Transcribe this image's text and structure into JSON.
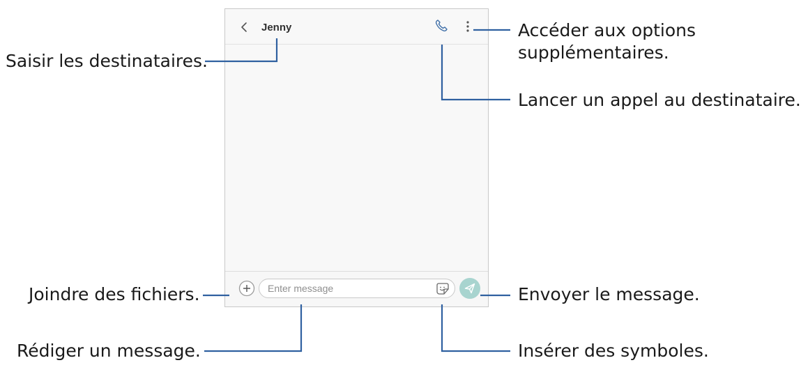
{
  "annotations": {
    "recipients": "Saisir les destinataires.",
    "more_options": "Accéder aux options supplémentaires.",
    "call": "Lancer un appel au destinataire.",
    "attach": "Joindre des fichiers.",
    "send": "Envoyer le message.",
    "compose": "Rédiger un message.",
    "symbols": "Insérer des symboles."
  },
  "screen": {
    "header": {
      "back_icon": "chevron-left-icon",
      "title": "Jenny",
      "call_icon": "phone-icon",
      "menu_icon": "more-vertical-icon"
    },
    "composer": {
      "attach_icon": "plus-icon",
      "placeholder": "Enter message",
      "emoji_icon": "sticker-icon",
      "send_icon": "send-icon"
    }
  },
  "colors": {
    "accent": "#3f6fa8",
    "send_button": "#a8d4cf",
    "callout_line": "#2f60a0"
  }
}
